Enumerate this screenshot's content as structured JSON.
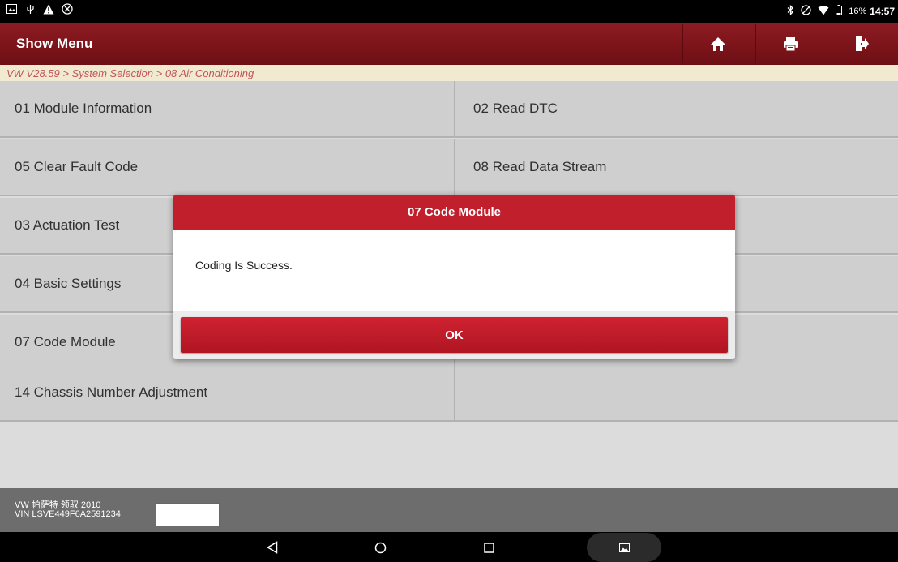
{
  "status_bar": {
    "left_icons": [
      "image-notification-icon",
      "usb-debug-icon",
      "warning-icon",
      "blocked-notification-icon"
    ],
    "right_icons": [
      "bluetooth-icon",
      "do-not-disturb-icon",
      "wifi-icon",
      "battery-icon"
    ],
    "battery_percent": "16%",
    "time": "14:57"
  },
  "app_bar": {
    "title": "Show Menu",
    "buttons": [
      "home-icon",
      "print-icon",
      "exit-icon"
    ]
  },
  "breadcrumb": "VW V28.59 > System Selection > 08 Air Conditioning",
  "menu": {
    "items": [
      {
        "label": "01 Module Information"
      },
      {
        "label": "02 Read DTC"
      },
      {
        "label": "05 Clear Fault Code"
      },
      {
        "label": "08 Read Data Stream"
      },
      {
        "label": "03 Actuation Test"
      },
      {
        "label": ""
      },
      {
        "label": "04 Basic Settings"
      },
      {
        "label": ""
      },
      {
        "label": "07 Code Module"
      },
      {
        "label": ""
      },
      {
        "label": "14 Chassis Number Adjustment"
      },
      {
        "label": ""
      }
    ]
  },
  "footer": {
    "vehicle": "VW 帕萨特 领驭 2010",
    "vin": "VIN LSVE449F6A2591234"
  },
  "nav_bar": {
    "buttons": [
      "back-icon",
      "home-circle-icon",
      "recents-icon",
      "screenshot-icon"
    ]
  },
  "dialog": {
    "title": "07 Code Module",
    "message": "Coding Is Success.",
    "ok_label": "OK"
  },
  "colors": {
    "app_bar": "#7f151c",
    "dialog_header": "#c11f2c",
    "ok_button": "#c01b2a",
    "breadcrumb_bg": "#f1ead0",
    "breadcrumb_text": "#c0555c",
    "menu_cell": "#cfcfcf",
    "footer": "#6d6d6d"
  }
}
